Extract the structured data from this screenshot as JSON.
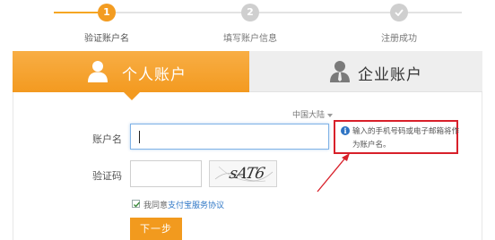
{
  "steps": [
    {
      "number": "1",
      "label": "验证账户名",
      "state": "active"
    },
    {
      "number": "2",
      "label": "填写账户信息",
      "state": "pending"
    },
    {
      "icon": "check-icon",
      "label": "注册成功",
      "state": "pending"
    }
  ],
  "tabs": {
    "personal": {
      "label": "个人账户",
      "icon": "person-icon",
      "selected": true
    },
    "company": {
      "label": "企业账户",
      "icon": "business-person-icon",
      "selected": false
    }
  },
  "form": {
    "region": "中国大陆",
    "username_label": "账户名",
    "username_value": "",
    "captcha_label": "验证码",
    "captcha_value": "",
    "captcha_image_text": "sAT6",
    "agree_prefix": "我同意",
    "agree_link": "支付宝服务协议",
    "agree_checked": true,
    "next_button": "下一步"
  },
  "hint": {
    "line1": "输入的手机号码或电子邮箱将作",
    "line2": "为账户名。"
  },
  "colors": {
    "accent": "#f39a20",
    "hint_border": "#d8202a",
    "link": "#2f77c6",
    "annotation_arrow": "#d8202a"
  }
}
